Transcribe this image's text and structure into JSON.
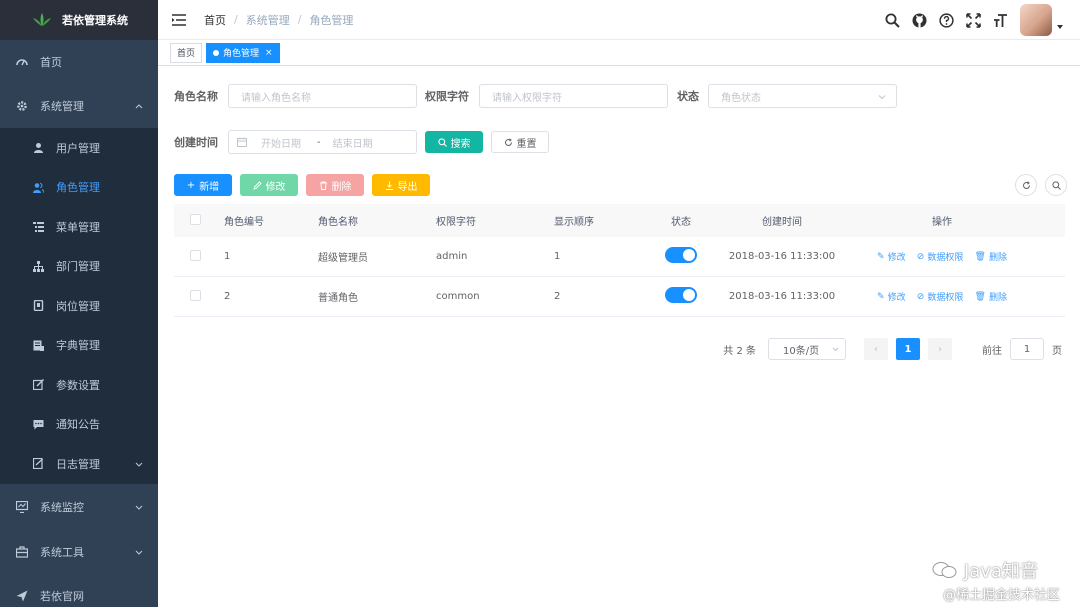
{
  "app": {
    "title": "若依管理系统"
  },
  "sidebar": {
    "items": [
      {
        "label": "首页",
        "icon": "dashboard-icon"
      },
      {
        "label": "系统管理",
        "icon": "gear-icon",
        "expanded": true
      }
    ],
    "sub_items": [
      {
        "label": "用户管理",
        "icon": "user-icon"
      },
      {
        "label": "角色管理",
        "icon": "peoples-icon",
        "active": true
      },
      {
        "label": "菜单管理",
        "icon": "tree-table-icon"
      },
      {
        "label": "部门管理",
        "icon": "tree-icon"
      },
      {
        "label": "岗位管理",
        "icon": "post-icon"
      },
      {
        "label": "字典管理",
        "icon": "dict-icon"
      },
      {
        "label": "参数设置",
        "icon": "edit-icon"
      },
      {
        "label": "通知公告",
        "icon": "message-icon"
      },
      {
        "label": "日志管理",
        "icon": "log-icon"
      }
    ],
    "bottom_items": [
      {
        "label": "系统监控",
        "icon": "monitor-icon"
      },
      {
        "label": "系统工具",
        "icon": "tool-icon"
      },
      {
        "label": "若依官网",
        "icon": "guide-icon"
      }
    ]
  },
  "breadcrumb": [
    "首页",
    "系统管理",
    "角色管理"
  ],
  "breadcrumb_sep": "/",
  "tags": [
    {
      "label": "首页"
    },
    {
      "label": "角色管理",
      "active": true,
      "close": "×"
    }
  ],
  "search": {
    "role_name_label": "角色名称",
    "role_name_placeholder": "请输入角色名称",
    "role_key_label": "权限字符",
    "role_key_placeholder": "请输入权限字符",
    "status_label": "状态",
    "status_placeholder": "角色状态",
    "created_label": "创建时间",
    "start_placeholder": "开始日期",
    "range_sep": "-",
    "end_placeholder": "结束日期",
    "search_btn": "搜索",
    "reset_btn": "重置"
  },
  "toolbar": {
    "add": "新增",
    "edit": "修改",
    "delete": "删除",
    "export": "导出"
  },
  "table": {
    "headers": [
      "角色编号",
      "角色名称",
      "权限字符",
      "显示顺序",
      "状态",
      "创建时间",
      "操作"
    ],
    "rows": [
      {
        "id": "1",
        "name": "超级管理员",
        "key": "admin",
        "sort": "1",
        "status_on": true,
        "created": "2018-03-16 11:33:00"
      },
      {
        "id": "2",
        "name": "普通角色",
        "key": "common",
        "sort": "2",
        "status_on": true,
        "created": "2018-03-16 11:33:00"
      }
    ],
    "ops": {
      "edit": "修改",
      "data_scope": "数据权限",
      "delete": "删除"
    }
  },
  "pagination": {
    "total": "共 2 条",
    "page_size": "10条/页",
    "prev": "‹",
    "current": "1",
    "next": "›",
    "goto_prefix": "前往",
    "goto_value": "1",
    "goto_suffix": "页"
  },
  "watermark": {
    "line1": "Java知音",
    "line2": "@稀土掘金技术社区"
  },
  "colors": {
    "sidebar_bg": "#304156",
    "sidebar_active": "#409eff",
    "primary": "#1890ff",
    "search": "#13b5a3",
    "warning": "#ffba00"
  }
}
